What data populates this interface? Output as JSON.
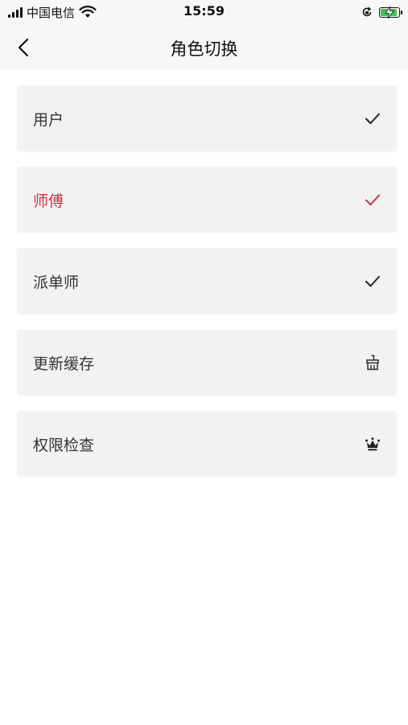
{
  "status_bar": {
    "carrier": "中国电信",
    "time": "15:59"
  },
  "nav": {
    "title": "角色切换",
    "back_icon": "chevron-left-icon"
  },
  "roles": [
    {
      "label": "用户",
      "icon": "checkmark-icon",
      "active": false
    },
    {
      "label": "师傅",
      "icon": "checkmark-icon",
      "active": true
    },
    {
      "label": "派单师",
      "icon": "checkmark-icon",
      "active": false
    }
  ],
  "actions": [
    {
      "label": "更新缓存",
      "icon": "broom-icon"
    },
    {
      "label": "权限检查",
      "icon": "crown-icon"
    }
  ],
  "colors": {
    "accent": "#d3313a",
    "row_bg": "#f2f2f2",
    "nav_bg": "#f7f7f7",
    "battery": "#35c759"
  }
}
